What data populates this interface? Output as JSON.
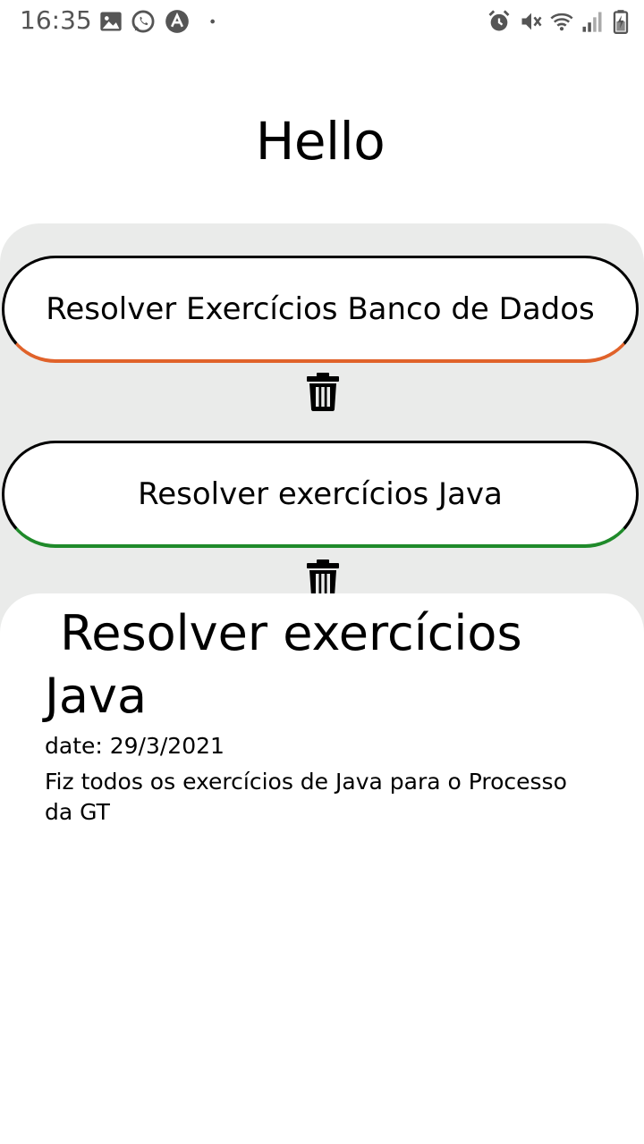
{
  "status_bar": {
    "time": "16:35",
    "left_icons": [
      "gallery-icon",
      "whatsapp-icon",
      "app-notification-icon",
      "dot-icon"
    ],
    "right_icons": [
      "alarm-icon",
      "mute-icon",
      "wifi-icon",
      "signal-icon",
      "battery-icon"
    ]
  },
  "header": {
    "title": "Hello"
  },
  "tasks": [
    {
      "label": "Resolver Exercícios Banco de Dados",
      "accent": "#e0622a"
    },
    {
      "label": "Resolver exercícios Java",
      "accent": "#1f8a2a"
    }
  ],
  "detail": {
    "title": " Resolver exercícios Java",
    "date": "date: 29/3/2021",
    "description": "Fiz todos os exercícios de Java para o Processo da GT"
  },
  "colors": {
    "list_background": "#eaebea",
    "status_icons": "#555555"
  }
}
